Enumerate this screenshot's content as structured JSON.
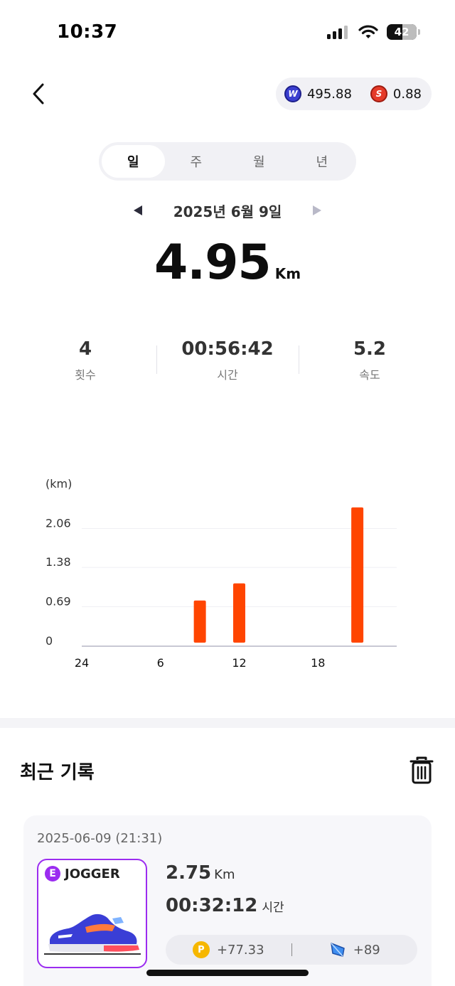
{
  "status_bar": {
    "time": "10:37",
    "battery": "42"
  },
  "wallet": {
    "w_balance": "495.88",
    "s_balance": "0.88"
  },
  "tabs": [
    {
      "label": "일",
      "active": true
    },
    {
      "label": "주",
      "active": false
    },
    {
      "label": "월",
      "active": false
    },
    {
      "label": "년",
      "active": false
    }
  ],
  "date": {
    "label": "2025년 6월 9일"
  },
  "summary": {
    "distance": "4.95",
    "unit": "Km"
  },
  "stats": [
    {
      "value": "4",
      "label": "횟수"
    },
    {
      "value": "00:56:42",
      "label": "시간"
    },
    {
      "value": "5.2",
      "label": "속도"
    }
  ],
  "chart_data": {
    "type": "bar",
    "ylabel": "(km)",
    "yticks": [
      "2.06",
      "1.38",
      "0.69",
      "0"
    ],
    "ylim": [
      0,
      2.75
    ],
    "xticks": [
      "24",
      "6",
      "12",
      "18"
    ],
    "xlim": [
      0,
      24
    ],
    "x": [
      9,
      12,
      21
    ],
    "values": [
      0.8,
      1.1,
      2.43
    ],
    "color": "#ff4500",
    "grid": true
  },
  "recent": {
    "title": "최근 기록",
    "records": [
      {
        "datetime": "2025-06-09 (21:31)",
        "shoe_grade": "E",
        "shoe_name": "JOGGER",
        "distance": "2.75",
        "distance_unit": "Km",
        "time": "00:32:12",
        "time_unit": "시간",
        "points": "+77.33",
        "energy": "+89"
      }
    ]
  }
}
